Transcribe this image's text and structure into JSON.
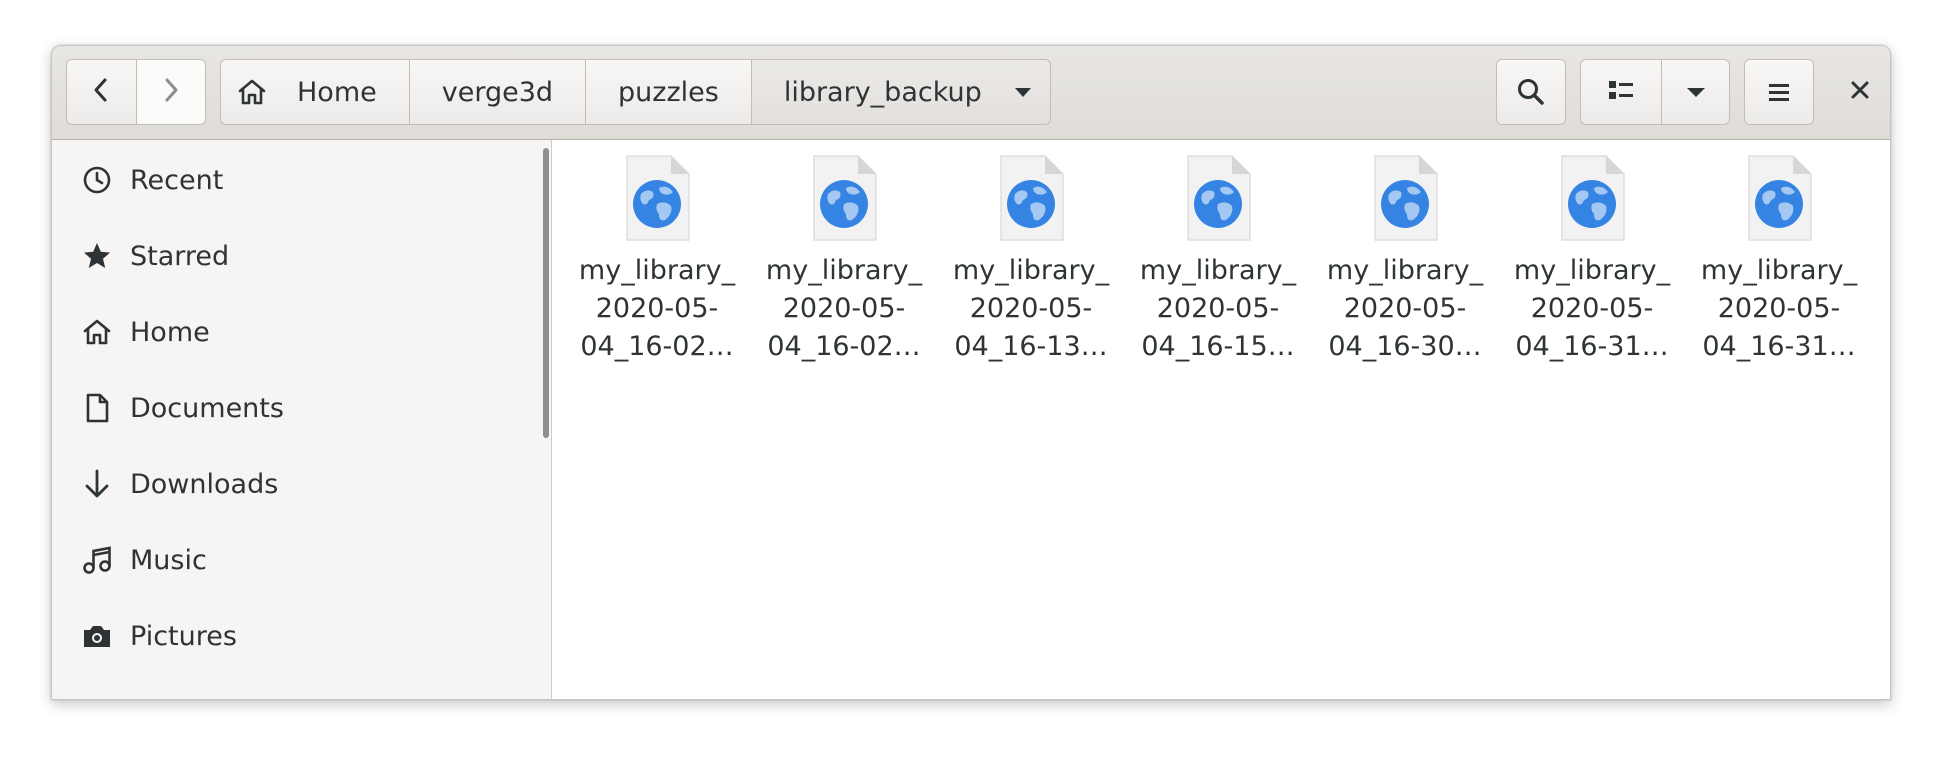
{
  "window": {
    "path": [
      {
        "label": "Home",
        "icon": "home-icon"
      },
      {
        "label": "verge3d"
      },
      {
        "label": "puzzles"
      },
      {
        "label": "library_backup",
        "icon": "chevron-down-icon"
      }
    ],
    "toolbar": {
      "back_icon": "back-arrow-icon",
      "forward_icon": "forward-arrow-icon",
      "search_icon": "search-icon",
      "view_icon": "list-view-icon",
      "view_options_icon": "chevron-down-icon",
      "menu_icon": "hamburger-menu-icon",
      "close_icon": "close-icon"
    }
  },
  "sidebar": {
    "items": [
      {
        "label": "Recent",
        "icon": "clock-icon"
      },
      {
        "label": "Starred",
        "icon": "star-icon"
      },
      {
        "label": "Home",
        "icon": "home-icon"
      },
      {
        "label": "Documents",
        "icon": "document-icon"
      },
      {
        "label": "Downloads",
        "icon": "download-arrow-icon"
      },
      {
        "label": "Music",
        "icon": "music-note-icon"
      },
      {
        "label": "Pictures",
        "icon": "camera-icon"
      }
    ]
  },
  "files": [
    {
      "line1": "my_library_",
      "line2": "2020-05-",
      "line3": "04_16-02…",
      "icon": "html-globe-file-icon"
    },
    {
      "line1": "my_library_",
      "line2": "2020-05-",
      "line3": "04_16-02…",
      "icon": "html-globe-file-icon"
    },
    {
      "line1": "my_library_",
      "line2": "2020-05-",
      "line3": "04_16-13…",
      "icon": "html-globe-file-icon"
    },
    {
      "line1": "my_library_",
      "line2": "2020-05-",
      "line3": "04_16-15…",
      "icon": "html-globe-file-icon"
    },
    {
      "line1": "my_library_",
      "line2": "2020-05-",
      "line3": "04_16-30…",
      "icon": "html-globe-file-icon"
    },
    {
      "line1": "my_library_",
      "line2": "2020-05-",
      "line3": "04_16-31…",
      "icon": "html-globe-file-icon"
    },
    {
      "line1": "my_library_",
      "line2": "2020-05-",
      "line3": "04_16-31…",
      "icon": "html-globe-file-icon"
    }
  ],
  "colors": {
    "accent": "#3584e4",
    "headerbar": "#e1dedb",
    "sidebar_bg": "#f6f5f4",
    "text": "#2e3436"
  }
}
